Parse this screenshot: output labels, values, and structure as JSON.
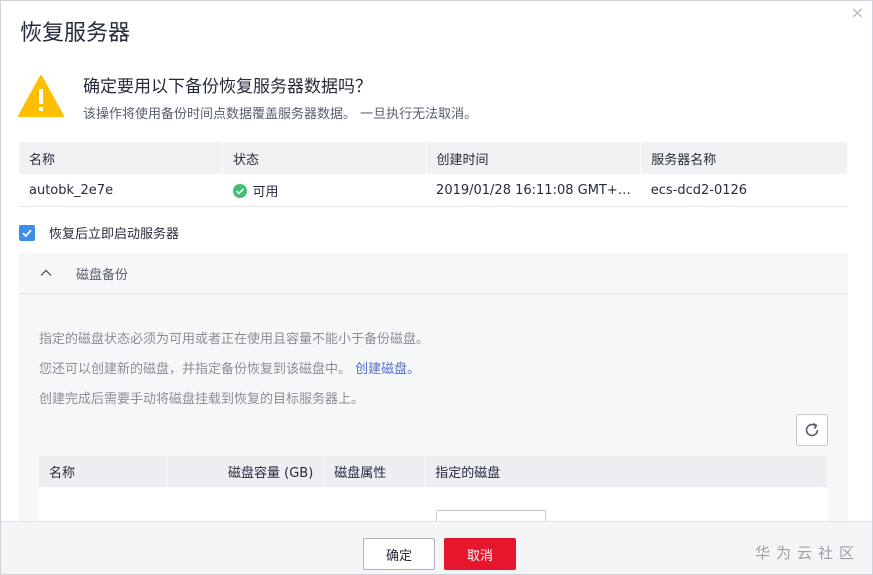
{
  "dialog": {
    "title": "恢复服务器",
    "close": "×",
    "confirm_question": "确定要用以下备份恢复服务器数据吗？",
    "confirm_sub": "该操作将使用备份时间点数据覆盖服务器数据。 一旦执行无法取消。"
  },
  "backup_table": {
    "headers": [
      "名称",
      "状态",
      "创建时间",
      "服务器名称"
    ],
    "row": {
      "name": "autobk_2e7e",
      "status": "可用",
      "created": "2019/01/28 16:11:08 GMT+…",
      "server": "ecs-dcd2-0126"
    }
  },
  "start_after_restore": {
    "label": "恢复后立即启动服务器",
    "checked": true
  },
  "disk_panel": {
    "title": "磁盘备份",
    "note1": "指定的磁盘状态必须为可用或者正在使用且容量不能小于备份磁盘。",
    "note2_prefix": "您还可以创建新的磁盘，并指定备份恢复到该磁盘中。",
    "note2_link": "创建磁盘。",
    "note3": "创建完成后需要手动将磁盘挂载到恢复的目标服务器上。",
    "headers": [
      "名称",
      "磁盘容量 (GB)",
      "磁盘属性",
      "指定的磁盘"
    ]
  },
  "footer": {
    "ok_label": "确定",
    "cancel_label": "取消",
    "watermark": "华为云社区"
  },
  "colors": {
    "primary_blue": "#3c8ee8",
    "cancel_red": "#e6162d",
    "status_green": "#3fbf74",
    "warning_yellow": "#ffbf00"
  }
}
